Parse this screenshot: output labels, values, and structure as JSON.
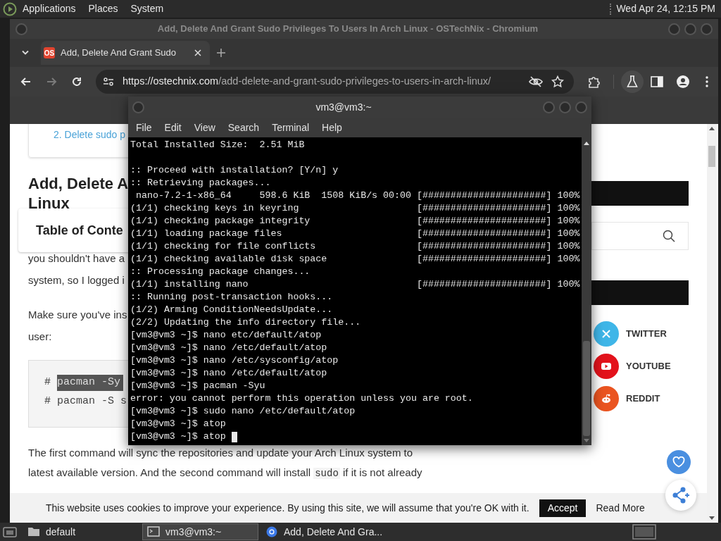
{
  "top_panel": {
    "menus": [
      "Applications",
      "Places",
      "System"
    ],
    "clock": "Wed Apr 24, 12:15 PM"
  },
  "browser": {
    "title": "Add, Delete And Grant Sudo Privileges To Users In Arch Linux - OSTechNix - Chromium",
    "tabs": [
      {
        "title": "Add, Delete And Grant Sudo",
        "favicon": "OS",
        "selected": true
      }
    ],
    "nav": [
      {
        "kind": "back",
        "disabled": false
      },
      {
        "kind": "forward",
        "disabled": true
      },
      {
        "kind": "reload",
        "disabled": false
      }
    ],
    "url": {
      "host": "https://ostechnix.com",
      "path": "/add-delete-and-grant-sudo-privileges-to-users-in-arch-linux/"
    }
  },
  "page": {
    "toc_link": "2. Delete sudo p",
    "heading": [
      "Add, Delete A",
      "Linux"
    ],
    "toc_title": "Table of Conte",
    "paragraphs": [
      {
        "text": "you shouldn't have a"
      },
      {
        "text": "system, so I logged i"
      },
      {
        "text": "Make sure you've ins",
        "gap_before": true
      },
      {
        "text": "user:"
      }
    ],
    "code": [
      {
        "prompt": "#",
        "command": "pacman -Sy",
        "highlighted": true
      },
      {
        "prompt": "#",
        "command": "pacman -S s",
        "highlighted": false
      }
    ],
    "after": [
      [
        {
          "text": "The first command will sync the repositories and update your Arch Linux system to"
        }
      ],
      [
        {
          "text": "latest available version. And the second command will install "
        },
        {
          "code": "sudo"
        },
        {
          "text": " if it is not already"
        }
      ]
    ],
    "social": [
      {
        "kind": "twitter",
        "label": "TWITTER",
        "color": "#3fb6e8"
      },
      {
        "kind": "youtube",
        "label": "YOUTUBE",
        "color": "#e3121b"
      },
      {
        "kind": "reddit",
        "label": "REDDIT",
        "color": "#ea5420"
      }
    ],
    "cookie": {
      "text": "This website uses cookies to improve your experience. By using this site, we will assume that you're OK with it.",
      "accept": "Accept",
      "read_more": "Read More"
    }
  },
  "terminal": {
    "title": "vm3@vm3:~",
    "menus": [
      "File",
      "Edit",
      "View",
      "Search",
      "Terminal",
      "Help"
    ],
    "cursor_visible": true,
    "lines": [
      {
        "text": "Total Installed Size:  2.51 MiB"
      },
      {
        "text": ":: Proceed with installation? [Y/n] y",
        "gap_before": true
      },
      {
        "text": ":: Retrieving packages..."
      },
      {
        "text": " nano-7.2-1-x86_64     598.6 KiB  1508 KiB/s 00:00 [######################] 100%"
      },
      {
        "text": "(1/1) checking keys in keyring                     [######################] 100%"
      },
      {
        "text": "(1/1) checking package integrity                   [######################] 100%"
      },
      {
        "text": "(1/1) loading package files                        [######################] 100%"
      },
      {
        "text": "(1/1) checking for file conflicts                  [######################] 100%"
      },
      {
        "text": "(1/1) checking available disk space                [######################] 100%"
      },
      {
        "text": ":: Processing package changes..."
      },
      {
        "text": "(1/1) installing nano                              [######################] 100%"
      },
      {
        "text": ":: Running post-transaction hooks..."
      },
      {
        "text": "(1/2) Arming ConditionNeedsUpdate..."
      },
      {
        "text": "(2/2) Updating the info directory file..."
      },
      {
        "text": "[vm3@vm3 ~]$ nano etc/default/atop"
      },
      {
        "text": "[vm3@vm3 ~]$ nano /etc/default/atop"
      },
      {
        "text": "[vm3@vm3 ~]$ nano /etc/sysconfig/atop"
      },
      {
        "text": "[vm3@vm3 ~]$ nano /etc/default/atop"
      },
      {
        "text": "[vm3@vm3 ~]$ pacman -Syu"
      },
      {
        "text": "error: you cannot perform this operation unless you are root."
      },
      {
        "text": "[vm3@vm3 ~]$ sudo nano /etc/default/atop"
      },
      {
        "text": "[vm3@vm3 ~]$ atop"
      },
      {
        "text": "[vm3@vm3 ~]$ atop "
      }
    ]
  },
  "taskbar": {
    "items": [
      {
        "kind": "folder",
        "label": "default",
        "selected": false
      },
      {
        "kind": "terminal",
        "label": "vm3@vm3:~",
        "selected": true
      },
      {
        "kind": "browser",
        "label": "Add, Delete And Gra...",
        "selected": false
      }
    ]
  }
}
